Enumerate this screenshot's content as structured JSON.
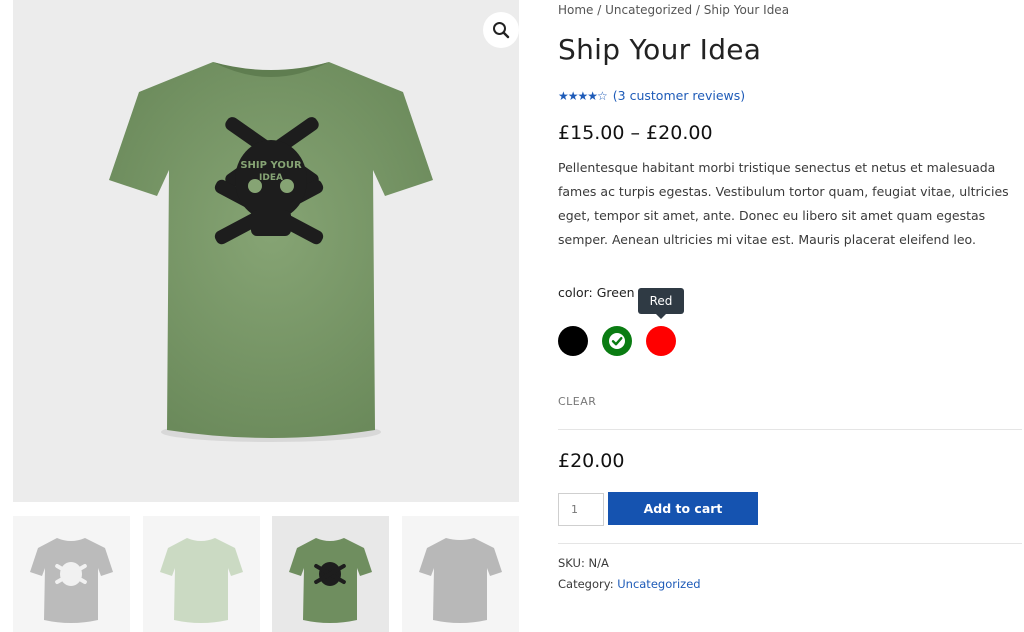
{
  "gallery": {
    "zoom_icon": "magnifier-icon",
    "main_shirt_color": "#7a9868",
    "shirt_text_line1": "SHIP YOUR",
    "shirt_text_line2": "IDEA",
    "thumbnails": [
      {
        "name": "grey-shirt-front",
        "color": "#8e8e8e"
      },
      {
        "name": "light-green-shirt",
        "color": "#a9c39c"
      },
      {
        "name": "green-shirt-front",
        "color": "#6f8e5f"
      },
      {
        "name": "grey-shirt-back",
        "color": "#8a8a8a"
      }
    ]
  },
  "breadcrumb": {
    "home": "Home",
    "sep1": " / ",
    "category": "Uncategorized",
    "sep2": " / ",
    "current": "Ship Your Idea"
  },
  "product": {
    "title": "Ship Your Idea",
    "rating": 4.3,
    "stars": "★★★★☆",
    "reviews_link": "(3 customer reviews)",
    "price_range": "£15.00 – £20.00",
    "description": "Pellentesque habitant morbi tristique senectus et netus et malesuada fames ac turpis egestas. Vestibulum tortor quam, feugiat vitae, ultricies eget, tempor sit amet, ante. Donec eu libero sit amet quam egestas semper. Aenean ultricies mi vitae est. Mauris placerat eleifend leo."
  },
  "variations": {
    "color_label": "color: Green",
    "tooltip": "Red",
    "swatches": [
      {
        "name": "Black",
        "color": "#000000",
        "selected": false
      },
      {
        "name": "Green",
        "color": "#0a7c12",
        "selected": true
      },
      {
        "name": "Red",
        "color": "#ff0000",
        "selected": false
      }
    ],
    "clear_label": "CLEAR",
    "variation_price": "£20.00"
  },
  "cart": {
    "quantity": "1",
    "add_button": "Add to cart"
  },
  "meta": {
    "sku_label": "SKU: ",
    "sku_value": "N/A",
    "category_label": "Category: ",
    "category_value": "Uncategorized"
  },
  "colors": {
    "accent": "#1553b0",
    "link": "#1e5bb8"
  }
}
